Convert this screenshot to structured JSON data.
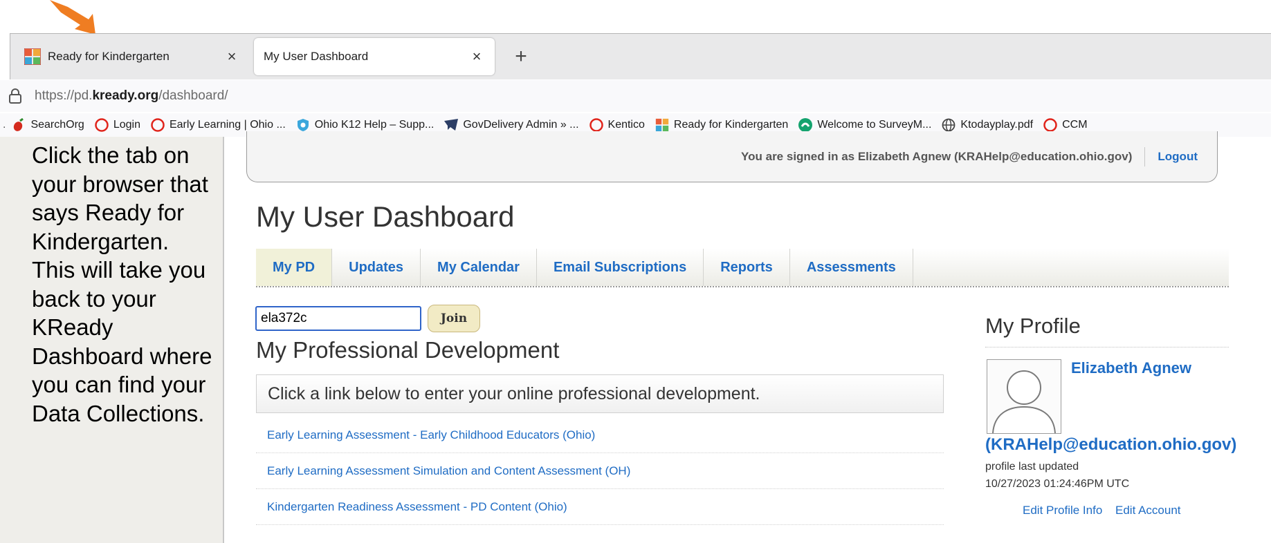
{
  "browser": {
    "tabs": [
      {
        "label": "Ready for Kindergarten",
        "active": false
      },
      {
        "label": "My User Dashboard",
        "active": true
      }
    ],
    "new_tab_symbol": "+",
    "close_symbol": "×",
    "url": {
      "prefix": "https://pd.",
      "domain": "kready.org",
      "path": "/dashboard/"
    },
    "bookmarks": [
      {
        "label": "SearchOrg",
        "icon": "pepper-icon"
      },
      {
        "label": "Login",
        "icon": "red-ring-icon"
      },
      {
        "label": "Early Learning | Ohio ...",
        "icon": "red-ring-icon"
      },
      {
        "label": "Ohio K12 Help – Supp...",
        "icon": "help-shield-icon"
      },
      {
        "label": "GovDelivery Admin » ...",
        "icon": "envelope-icon"
      },
      {
        "label": "Kentico",
        "icon": "red-ring-icon"
      },
      {
        "label": "Ready for Kindergarten",
        "icon": "grid-icon"
      },
      {
        "label": "Welcome to SurveyM...",
        "icon": "survey-icon"
      },
      {
        "label": "Ktodayplay.pdf",
        "icon": "globe-icon"
      },
      {
        "label": "CCM",
        "icon": "red-ring-icon"
      }
    ]
  },
  "instruction": {
    "text": "Click the tab on your browser that says Ready for Kindergarten. This will take you back to your KReady Dashboard where you can find your Data Collections."
  },
  "header": {
    "signin_text": "You are signed in as Elizabeth Agnew (KRAHelp@education.ohio.gov)",
    "logout": "Logout"
  },
  "page": {
    "title": "My User Dashboard",
    "nav_tabs": [
      "My PD",
      "Updates",
      "My Calendar",
      "Email Subscriptions",
      "Reports",
      "Assessments"
    ]
  },
  "join": {
    "input_value": "ela372c",
    "button_label": "Join"
  },
  "pd": {
    "heading": "My Professional Development",
    "prompt": "Click a link below to enter your online professional development.",
    "links": [
      "Early Learning Assessment - Early Childhood Educators (Ohio)",
      "Early Learning Assessment Simulation and Content Assessment (OH)",
      "Kindergarten Readiness Assessment - PD Content (Ohio)"
    ]
  },
  "profile": {
    "heading": "My Profile",
    "name": "Elizabeth Agnew",
    "email": "(KRAHelp@education.ohio.gov)",
    "updated_label": "profile last updated",
    "updated_value": "10/27/2023 01:24:46PM UTC",
    "edit_profile": "Edit Profile Info",
    "edit_account": "Edit Account"
  },
  "colors": {
    "link": "#1f6cc4",
    "accent_arrow": "#ef7d22",
    "active_tab_bg": "#f1f1d9"
  }
}
